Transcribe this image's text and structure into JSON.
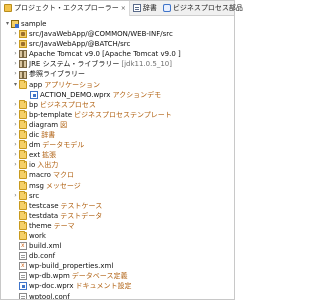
{
  "tabs": [
    {
      "label": "プロジェクト・エクスプローラー",
      "icon": "explorer-icon"
    },
    {
      "label": "辞書",
      "icon": "dictionary-icon"
    },
    {
      "label": "ビジネスプロセス部品",
      "icon": "process-icon"
    }
  ],
  "tab_close": "×",
  "tree": [
    {
      "name": "sample",
      "icon": "project",
      "twisty": "▾",
      "depth": 0
    },
    {
      "name": "src/JavaWebApp/@COMMON/WEB-INF/src",
      "icon": "srcfolder",
      "twisty": "›",
      "depth": 1
    },
    {
      "name": "src/JavaWebApp/@BATCH/src",
      "icon": "srcfolder",
      "twisty": "›",
      "depth": 1
    },
    {
      "name": "Apache Tomcat v9.0 [Apache Tomcat v9.0 ]",
      "icon": "lib",
      "twisty": "›",
      "depth": 1
    },
    {
      "name": "JRE システム・ライブラリー",
      "sub": "[jdk11.0.5_10]",
      "subgray": true,
      "icon": "lib",
      "twisty": "›",
      "depth": 1
    },
    {
      "name": "参照ライブラリー",
      "icon": "lib",
      "twisty": "›",
      "depth": 1
    },
    {
      "name": "app",
      "sub": "アプリケーション",
      "icon": "folder",
      "twisty": "▾",
      "depth": 1
    },
    {
      "name": "ACTION_DEMO.wprx",
      "sub": "アクションデモ",
      "icon": "wprx",
      "twisty": "",
      "depth": 2
    },
    {
      "name": "bp",
      "sub": "ビジネスプロセス",
      "icon": "folder",
      "twisty": "›",
      "depth": 1
    },
    {
      "name": "bp-template",
      "sub": "ビジネスプロセステンプレート",
      "icon": "folder",
      "twisty": "›",
      "depth": 1
    },
    {
      "name": "diagram",
      "sub": "図",
      "icon": "folder",
      "twisty": "›",
      "depth": 1
    },
    {
      "name": "dic",
      "sub": "辞書",
      "icon": "folder",
      "twisty": "›",
      "depth": 1
    },
    {
      "name": "dm",
      "sub": "データモデル",
      "icon": "folder",
      "twisty": "›",
      "depth": 1
    },
    {
      "name": "ext",
      "sub": "拡張",
      "icon": "folder",
      "twisty": "›",
      "depth": 1
    },
    {
      "name": "io",
      "sub": "入出力",
      "icon": "folder",
      "twisty": "›",
      "depth": 1
    },
    {
      "name": "macro",
      "sub": "マクロ",
      "icon": "folder",
      "twisty": "",
      "depth": 1
    },
    {
      "name": "msg",
      "sub": "メッセージ",
      "icon": "folder",
      "twisty": "",
      "depth": 1
    },
    {
      "name": "src",
      "icon": "folder",
      "twisty": "›",
      "depth": 1
    },
    {
      "name": "testcase",
      "sub": "テストケース",
      "icon": "folder",
      "twisty": "",
      "depth": 1
    },
    {
      "name": "testdata",
      "sub": "テストデータ",
      "icon": "folder",
      "twisty": "",
      "depth": 1
    },
    {
      "name": "theme",
      "sub": "テーマ",
      "icon": "folder",
      "twisty": "",
      "depth": 1
    },
    {
      "name": "work",
      "icon": "folder",
      "twisty": "",
      "depth": 1
    },
    {
      "name": "build.xml",
      "icon": "xml",
      "twisty": "",
      "depth": 1
    },
    {
      "name": "db.conf",
      "icon": "file",
      "twisty": "",
      "depth": 1
    },
    {
      "name": "wp-build_properties.xml",
      "icon": "xml",
      "twisty": "",
      "depth": 1
    },
    {
      "name": "wp-db.wpm",
      "sub": "データベース定義",
      "icon": "file",
      "twisty": "",
      "depth": 1
    },
    {
      "name": "wp-doc.wprx",
      "sub": "ドキュメント設定",
      "icon": "wprx",
      "twisty": "",
      "depth": 1
    },
    {
      "name": "wptool.conf",
      "icon": "file",
      "twisty": "",
      "depth": 1
    }
  ]
}
